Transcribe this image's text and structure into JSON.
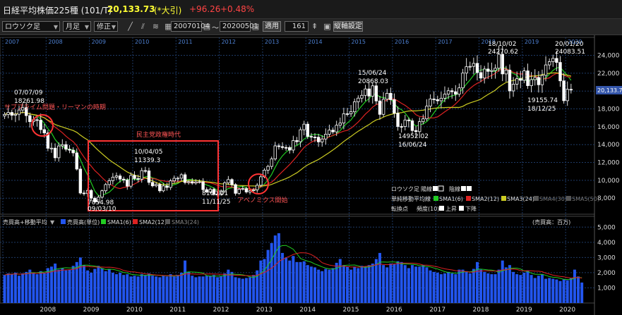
{
  "header": {
    "index_name": "日経平均株価225種 (101/T)",
    "price": "20,133.73",
    "price_note": "(*大引)",
    "change": "+96.26",
    "change_pct": "+0.48%"
  },
  "toolbar": {
    "chart_type": "ロウソク足",
    "period": "月足",
    "adjust": "修正",
    "start_date": "20070104",
    "tilde": "～",
    "end_date": "20200501",
    "apply_label": "適用",
    "count": "161",
    "pin_glyph": "⇞",
    "settings_label": "縦軸設定"
  },
  "colors": {
    "up_candle": "#ffffff",
    "down_candle": "#ffffff",
    "sma1": "#22cc22",
    "sma2": "#dd2222",
    "sma3": "#cccc22",
    "volume_bar": "#2255ee",
    "annotation": "#ff3333",
    "current_price_box": "#3355aa"
  },
  "price_panel": {
    "current_price_label": "20,133.73",
    "legend": {
      "candle_label": "ロウソク足",
      "up_label": "陽線",
      "down_label": "陰線",
      "ma_label": "単純移動平均線",
      "sma1": "SMA1(6)",
      "sma2": "SMA2(12)",
      "sma3": "SMA3(24)",
      "sma4": "SMA4(30)",
      "sma5": "SMA5(50)",
      "trend_label": "転換点",
      "trend_param": "頻度(10)",
      "trend_up": "上昇",
      "trend_down": "下降"
    },
    "annotations": {
      "peak_date": "07/07/09",
      "peak_value": "18261.98",
      "subprime": "サブプライム問題・リーマンの時期",
      "dpj": "民主党政権時代",
      "abenomics": "アベノミクス開始",
      "low_2009_value": "7054.98",
      "low_2009_date": "09/03/10",
      "high_2010_date": "10/04/05",
      "high_2010_value": "11339.3",
      "low_2011_value": "8160.01",
      "low_2011_date": "11/11/25",
      "high_2015_date": "15/06/24",
      "high_2015_value": "20868.03",
      "low_2016_value": "14952.02",
      "low_2016_date": "16/06/24",
      "high_2018_date": "18/10/02",
      "high_2018_value": "24270.62",
      "low_2018_value": "19155.74",
      "low_2018_date": "18/12/25",
      "high_2020_date": "20/01/20",
      "high_2020_value": "24083.51"
    }
  },
  "volume_panel": {
    "legend_title": "売買高+移動平均",
    "vol_label": "売買高(単位)",
    "sma1": "SMA1(6)",
    "sma2": "SMA2(12)",
    "sma3": "SMA3(24)",
    "unit_label": "(売買高：百万)"
  },
  "chart_data": [
    {
      "type": "candlestick",
      "title": "日経平均株価225種 (101/T) 月足",
      "x_start": "2007-01",
      "x_end": "2020-05",
      "top_year_labels": [
        "2007",
        "2008",
        "2009",
        "2010",
        "2011",
        "2012",
        "2013",
        "2014",
        "2015",
        "2016",
        "2017",
        "2018",
        "2019",
        "2020"
      ],
      "bottom_year_labels": [
        "2008",
        "2009",
        "2010",
        "2011",
        "2012",
        "2013",
        "2014",
        "2015",
        "2016",
        "2017",
        "2018",
        "2019",
        "2020"
      ],
      "y_ticks": [
        8000,
        10000,
        12000,
        14000,
        16000,
        18000,
        20000,
        22000,
        24000
      ],
      "y_tick_labels": [
        "8,000",
        "10,000",
        "12,000",
        "14,000",
        "16,000",
        "18,000",
        "20,000",
        "22,000",
        "24,000"
      ],
      "ylim": [
        6200,
        25700
      ],
      "grid": true,
      "close": [
        17383,
        17604,
        17288,
        17400,
        17875,
        18138,
        17248,
        16569,
        16785,
        16737,
        15680,
        15308,
        13592,
        13603,
        12525,
        13849,
        13998,
        13481,
        13376,
        13072,
        11259,
        8576,
        8512,
        8859,
        7994,
        7568,
        8109,
        8828,
        9522,
        9958,
        10356,
        10492,
        10133,
        10034,
        9345,
        10546,
        10198,
        10126,
        11089,
        11057,
        9768,
        9382,
        9537,
        8824,
        9369,
        9202,
        9937,
        10228,
        10237,
        10624,
        9755,
        9849,
        9693,
        9816,
        9833,
        8955,
        8700,
        8988,
        8434,
        8455,
        8802,
        9723,
        10084,
        9520,
        8542,
        9007,
        9070,
        8695,
        8839,
        8928,
        9446,
        10395,
        11138,
        11559,
        12397,
        13860,
        13774,
        13677,
        13668,
        13388,
        14455,
        14327,
        15661,
        16291,
        14914,
        14841,
        14827,
        14304,
        14632,
        15162,
        15621,
        15425,
        16173,
        16413,
        17459,
        17450,
        17674,
        18797,
        19207,
        19520,
        20236,
        19434,
        20585,
        18890,
        17388,
        19083,
        19747,
        19034,
        17518,
        16027,
        16026,
        16759,
        16666,
        15575,
        15454,
        16569,
        16887,
        18308,
        19114,
        19041,
        18909,
        19197,
        19651,
        20033,
        19925,
        19646,
        20356,
        22012,
        22725,
        22765,
        23098,
        22068,
        21454,
        22468,
        22202,
        22305,
        22554,
        24120,
        21920,
        22351,
        20015,
        20773,
        21385,
        21206,
        22259,
        20601,
        21276,
        21522,
        20704,
        21756,
        22927,
        23294,
        23656,
        23205,
        21143,
        18917,
        20194,
        20133
      ],
      "labeled_points": [
        {
          "date": "2007-07-09",
          "value": 18261.98,
          "kind": "high"
        },
        {
          "date": "2009-03-10",
          "value": 7054.98,
          "kind": "low"
        },
        {
          "date": "2010-04-05",
          "value": 11339.3,
          "kind": "high"
        },
        {
          "date": "2011-11-25",
          "value": 8160.01,
          "kind": "low"
        },
        {
          "date": "2015-06-24",
          "value": 20868.03,
          "kind": "high"
        },
        {
          "date": "2016-06-24",
          "value": 14952.02,
          "kind": "low"
        },
        {
          "date": "2018-10-02",
          "value": 24270.62,
          "kind": "high"
        },
        {
          "date": "2018-12-25",
          "value": 19155.74,
          "kind": "low"
        },
        {
          "date": "2020-01-20",
          "value": 24083.51,
          "kind": "high"
        }
      ],
      "series": [
        {
          "name": "SMA1(6)",
          "color": "#22cc22",
          "period": 6
        },
        {
          "name": "SMA2(12)",
          "color": "#dd2222",
          "period": 12
        },
        {
          "name": "SMA3(24)",
          "color": "#cccc22",
          "period": 24
        }
      ]
    },
    {
      "type": "bar",
      "title": "売買高+移動平均",
      "ylabel": "(売買高：百万)",
      "y_ticks": [
        1000,
        2000,
        3000,
        4000,
        5000
      ],
      "y_tick_labels": [
        "1,000",
        "2,000",
        "3,000",
        "4,000",
        "5,000"
      ],
      "ylim": [
        0,
        5200
      ],
      "grid": true,
      "values": [
        1850,
        1950,
        1900,
        2000,
        1800,
        1950,
        2050,
        2200,
        2000,
        1900,
        2100,
        2000,
        2300,
        2400,
        2600,
        2200,
        2300,
        2150,
        2200,
        2450,
        2700,
        3000,
        2500,
        2150,
        2000,
        2250,
        2450,
        2300,
        2100,
        2250,
        2000,
        1900,
        2000,
        1850,
        1900,
        1750,
        1800,
        1750,
        1900,
        1850,
        1950,
        1800,
        1750,
        1700,
        1800,
        1750,
        1900,
        1750,
        1850,
        2000,
        2800,
        2050,
        1800,
        1700,
        1750,
        1750,
        1800,
        1800,
        1850,
        1700,
        1750,
        1950,
        2200,
        2050,
        1700,
        1650,
        1600,
        1650,
        1700,
        1850,
        2150,
        2800,
        2900,
        3500,
        3950,
        4450,
        4600,
        3300,
        3000,
        2800,
        3100,
        2700,
        2700,
        2750,
        2500,
        2400,
        2350,
        2200,
        2100,
        2250,
        2200,
        2300,
        2650,
        2900,
        2500,
        2400,
        2200,
        2400,
        2300,
        2450,
        2400,
        2500,
        2600,
        2900,
        3300,
        2500,
        2350,
        2600,
        2550,
        2750,
        2700,
        2500,
        2300,
        2500,
        2400,
        2400,
        2500,
        2350,
        2150,
        2050,
        2000,
        1900,
        1950,
        2050,
        1950,
        1900,
        2200,
        2200,
        2100,
        1950,
        2250,
        2700,
        2200,
        2050,
        1950,
        1900,
        1900,
        2200,
        2800,
        2350,
        2500,
        2050,
        1900,
        1850,
        2000,
        2150,
        1850,
        1650,
        1800,
        1900,
        1600,
        1650,
        1600,
        1550,
        1450,
        1550,
        1500,
        1650,
        2200,
        1750,
        1350
      ]
    }
  ]
}
